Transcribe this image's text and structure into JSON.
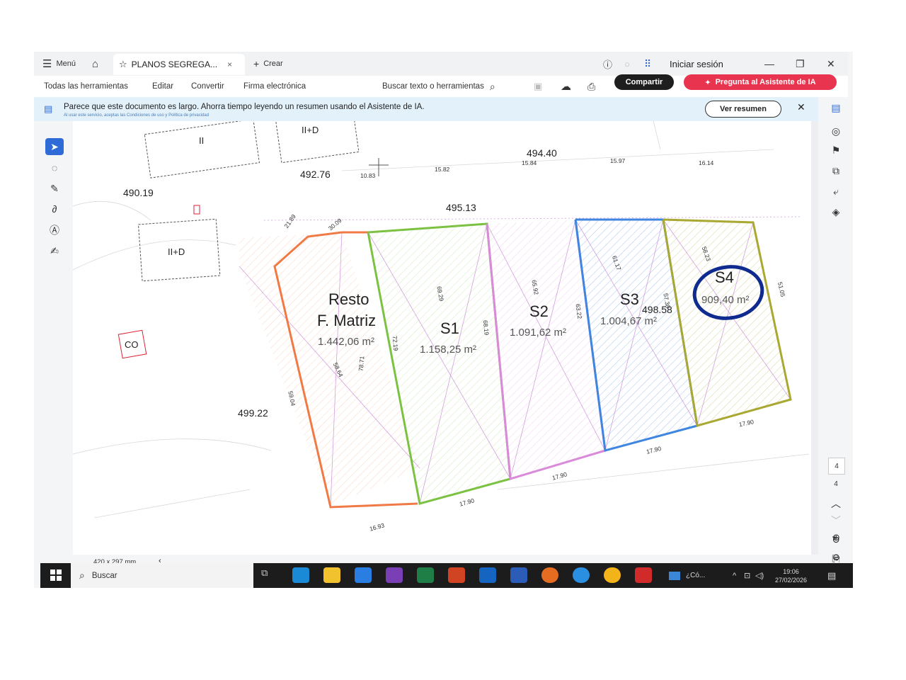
{
  "topbar": {
    "menu_label": "Menú",
    "tab_title": "PLANOS SEGREGA...",
    "create_label": "Crear",
    "signin_label": "Iniciar sesión"
  },
  "menubar": {
    "items": [
      "Todas las herramientas",
      "Editar",
      "Convertir",
      "Firma electrónica"
    ],
    "search_placeholder": "Buscar texto o herramientas",
    "share_label": "Compartir",
    "ai_label": "Pregunta al Asistente de IA"
  },
  "banner": {
    "text": "Parece que este documento es largo. Ahorra tiempo leyendo un resumen usando el Asistente de IA.",
    "subtext": "Al usar este servicio, aceptas las Condiciones de uso y Política de privacidad",
    "summary_button": "Ver resumen"
  },
  "plan": {
    "elevations": [
      "490.19",
      "492.76",
      "494.40",
      "495.13",
      "498.58",
      "499.22"
    ],
    "buildings": [
      "II",
      "II+D",
      "II+D",
      "CO"
    ],
    "segments": [
      "10.83",
      "15.82",
      "15.84",
      "15.97",
      "16.14",
      "21.89",
      "30.09",
      "51.05",
      "58.23",
      "17.90",
      "17.90",
      "17.90",
      "17.90",
      "16.93",
      "59.04",
      "58.64",
      "78.71",
      "72.19",
      "69.29",
      "68.19",
      "65.92",
      "63.22",
      "61.17",
      "57.38"
    ],
    "parcels": [
      {
        "name": "Resto",
        "name2": "F. Matriz",
        "area": "1.442,06 m²",
        "color": "#f07a45"
      },
      {
        "name": "S1",
        "area": "1.158,25 m²",
        "color": "#7cc242"
      },
      {
        "name": "S2",
        "area": "1.091,62 m²",
        "color": "#d98ad8"
      },
      {
        "name": "S3",
        "area": "1.004,67 m²",
        "color": "#3f86e0"
      },
      {
        "name": "S4",
        "area": "909,40 m²",
        "color": "#a9a832"
      }
    ],
    "highlight_color": "#0f2b8f"
  },
  "page_nav": {
    "current": "4",
    "total": "4"
  },
  "status": {
    "page_size": "420 x 297 mm"
  },
  "taskbar": {
    "search_label": "Buscar",
    "app_label": "¿Có...",
    "time": "19:06",
    "date": "27/02/2026"
  }
}
